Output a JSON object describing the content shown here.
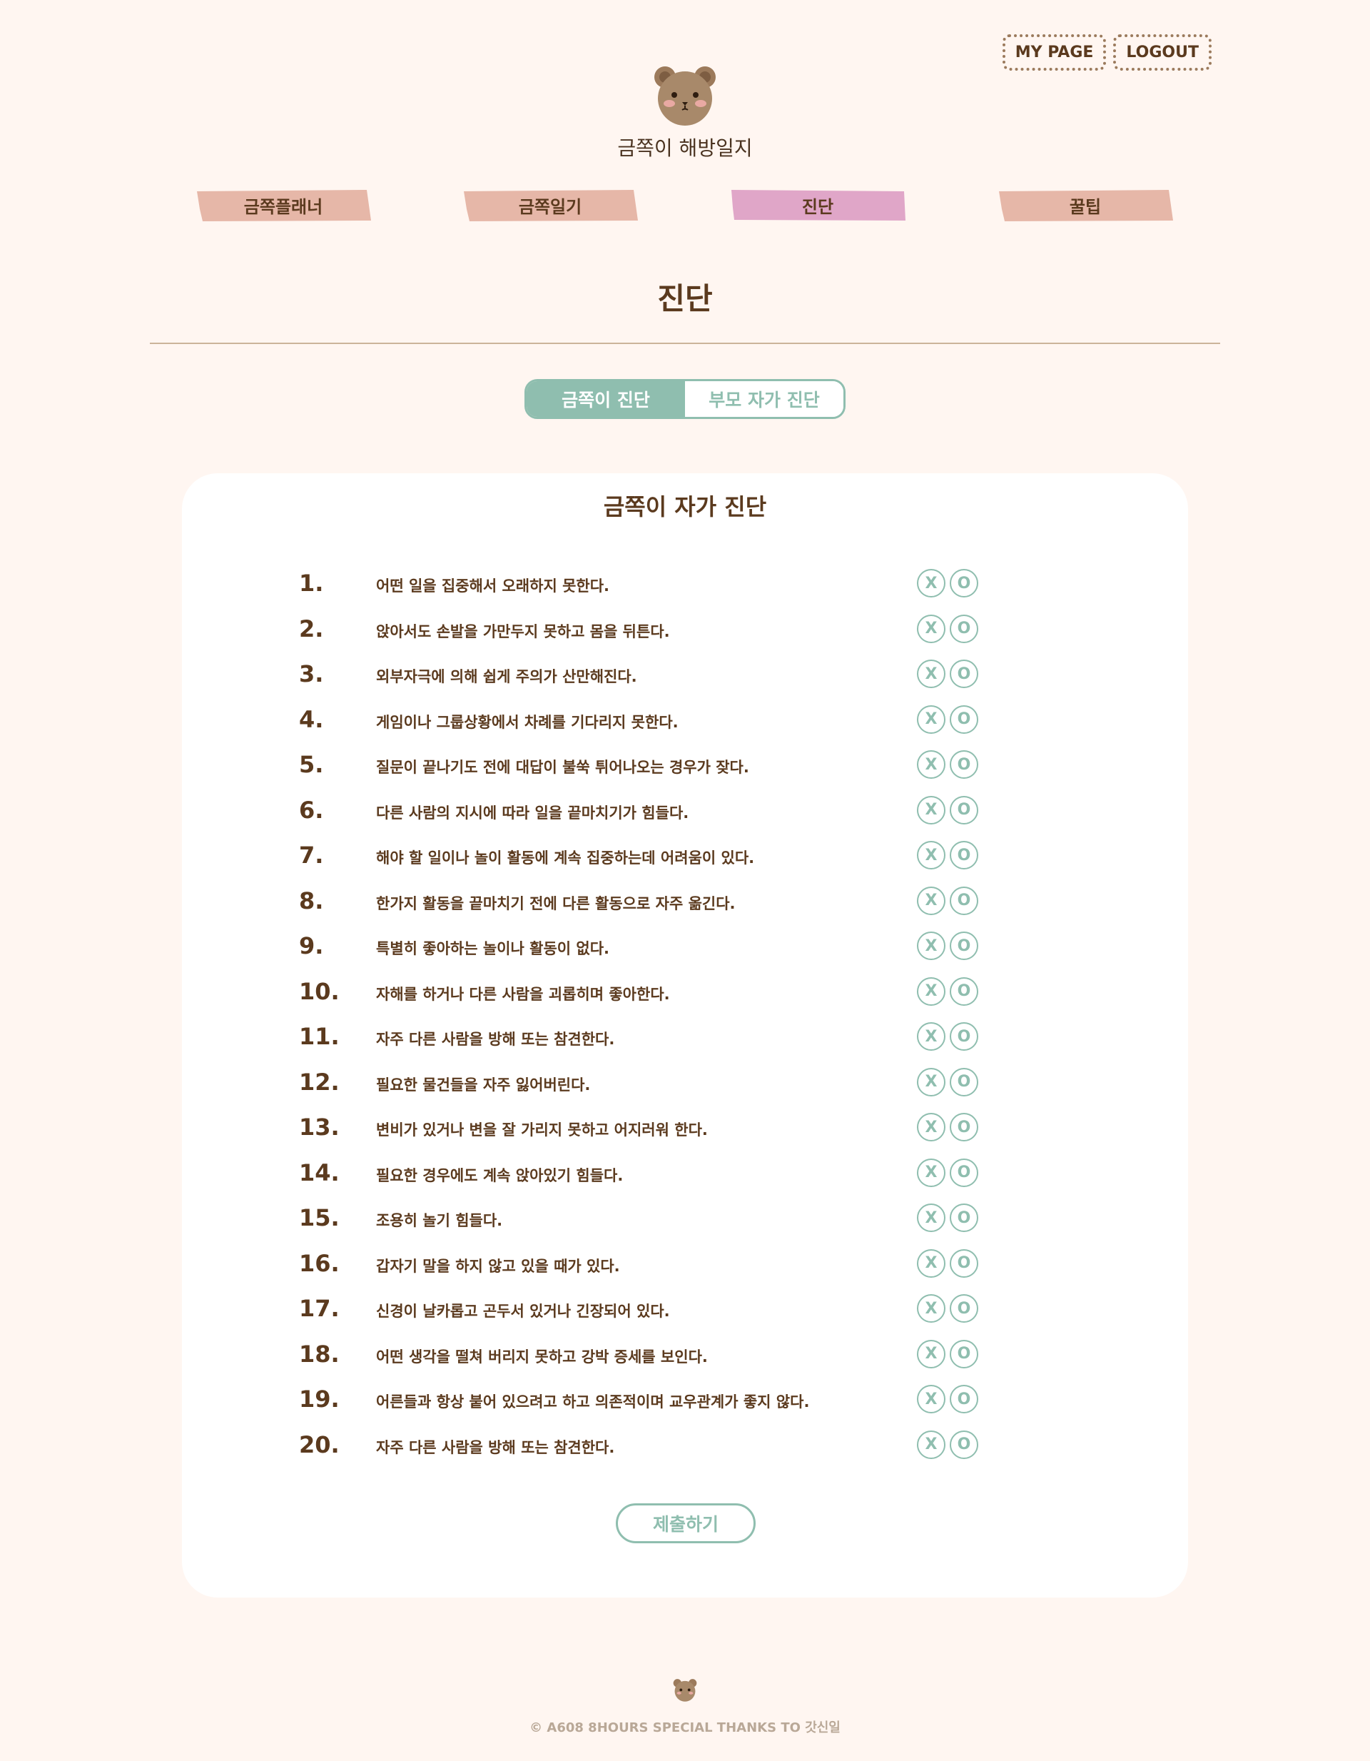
{
  "header": {
    "my_page": "MY PAGE",
    "logout": "LOGOUT",
    "logo_title": "금쪽이 해방일지"
  },
  "nav": {
    "items": [
      {
        "label": "금쪽플래너",
        "color": "#e6b7a8"
      },
      {
        "label": "금쪽일기",
        "color": "#e6b7a8"
      },
      {
        "label": "진단",
        "color": "#e0a6c8",
        "active": true
      },
      {
        "label": "꿀팁",
        "color": "#e6b7a8"
      }
    ]
  },
  "page": {
    "title": "진단"
  },
  "tabs": [
    {
      "label": "금쪽이 진단",
      "active": true
    },
    {
      "label": "부모 자가 진단",
      "active": false
    }
  ],
  "survey": {
    "title": "금쪽이 자가 진단",
    "no_label": "X",
    "yes_label": "O",
    "questions": [
      {
        "num": "1.",
        "text": "어떤 일을 집중해서 오래하지 못한다."
      },
      {
        "num": "2.",
        "text": "앉아서도 손발을 가만두지 못하고 몸을 뒤튼다."
      },
      {
        "num": "3.",
        "text": "외부자극에 의해 쉽게 주의가 산만해진다."
      },
      {
        "num": "4.",
        "text": "게임이나 그룹상황에서 차례를 기다리지 못한다."
      },
      {
        "num": "5.",
        "text": "질문이 끝나기도 전에 대답이 불쑥 튀어나오는 경우가 잦다."
      },
      {
        "num": "6.",
        "text": "다른 사람의 지시에 따라 일을 끝마치기가 힘들다."
      },
      {
        "num": "7.",
        "text": "해야 할 일이나 놀이 활동에 계속 집중하는데 어려움이 있다."
      },
      {
        "num": "8.",
        "text": "한가지 활동을 끝마치기 전에 다른 활동으로 자주 옮긴다."
      },
      {
        "num": "9.",
        "text": "특별히 좋아하는 놀이나 활동이 없다."
      },
      {
        "num": "10.",
        "text": "자해를 하거나 다른 사람을 괴롭히며 좋아한다."
      },
      {
        "num": "11.",
        "text": "자주 다른 사람을 방해 또는 참견한다."
      },
      {
        "num": "12.",
        "text": "필요한 물건들을 자주 잃어버린다."
      },
      {
        "num": "13.",
        "text": "변비가 있거나 변을 잘 가리지 못하고 어지러워 한다."
      },
      {
        "num": "14.",
        "text": "필요한 경우에도 계속 앉아있기 힘들다."
      },
      {
        "num": "15.",
        "text": "조용히 놀기 힘들다."
      },
      {
        "num": "16.",
        "text": "갑자기 말을 하지 않고 있을 때가 있다."
      },
      {
        "num": "17.",
        "text": "신경이 날카롭고 곤두서 있거나 긴장되어 있다."
      },
      {
        "num": "18.",
        "text": "어떤 생각을 떨쳐 버리지 못하고 강박 증세를 보인다."
      },
      {
        "num": "19.",
        "text": "어른들과 항상 붙어 있으려고 하고 의존적이며 교우관계가 좋지 않다."
      },
      {
        "num": "20.",
        "text": "자주 다른 사람을 방해 또는 참견한다."
      }
    ],
    "submit": "제출하기"
  },
  "footer": {
    "text": "© A608 8HOURS SPECIAL THANKS TO 갓신일"
  },
  "colors": {
    "background": "#fff6f1",
    "accent": "#8fbeaf",
    "text": "#5b3a1e"
  }
}
